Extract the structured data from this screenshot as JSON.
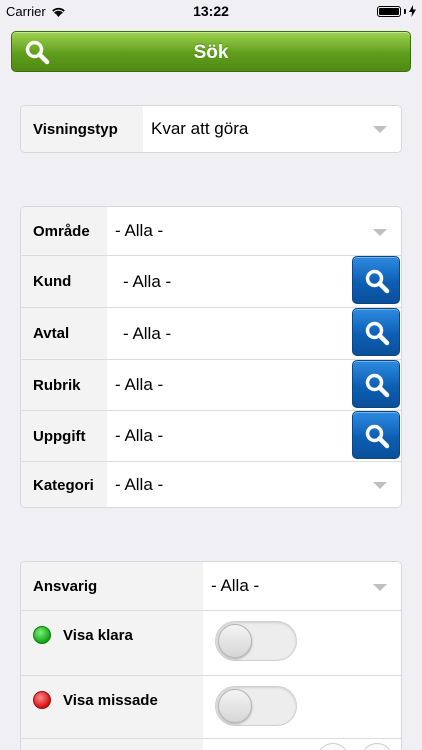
{
  "status_bar": {
    "carrier": "Carrier",
    "time": "13:22"
  },
  "search_button": {
    "label": "Sök"
  },
  "view_type": {
    "label": "Visningstyp",
    "value": "Kvar att göra"
  },
  "filters": {
    "area": {
      "label": "Område",
      "value": "- Alla -"
    },
    "customer": {
      "label": "Kund",
      "value": "- Alla -"
    },
    "contract": {
      "label": "Avtal",
      "value": "- Alla -"
    },
    "heading": {
      "label": "Rubrik",
      "value": "- Alla -"
    },
    "task": {
      "label": "Uppgift",
      "value": "- Alla -"
    },
    "category": {
      "label": "Kategori",
      "value": "- Alla -"
    }
  },
  "options": {
    "responsible": {
      "label": "Ansvarig",
      "value": "- Alla -"
    },
    "show_done": {
      "label": "Visa klara",
      "enabled": false,
      "status_color": "#15a515"
    },
    "show_missed": {
      "label": "Visa missade",
      "enabled": false,
      "status_color": "#d40f0f"
    }
  },
  "colors": {
    "accent_green": "#5f9d1c",
    "accent_blue": "#0d5fb4",
    "background": "#efeff4"
  }
}
